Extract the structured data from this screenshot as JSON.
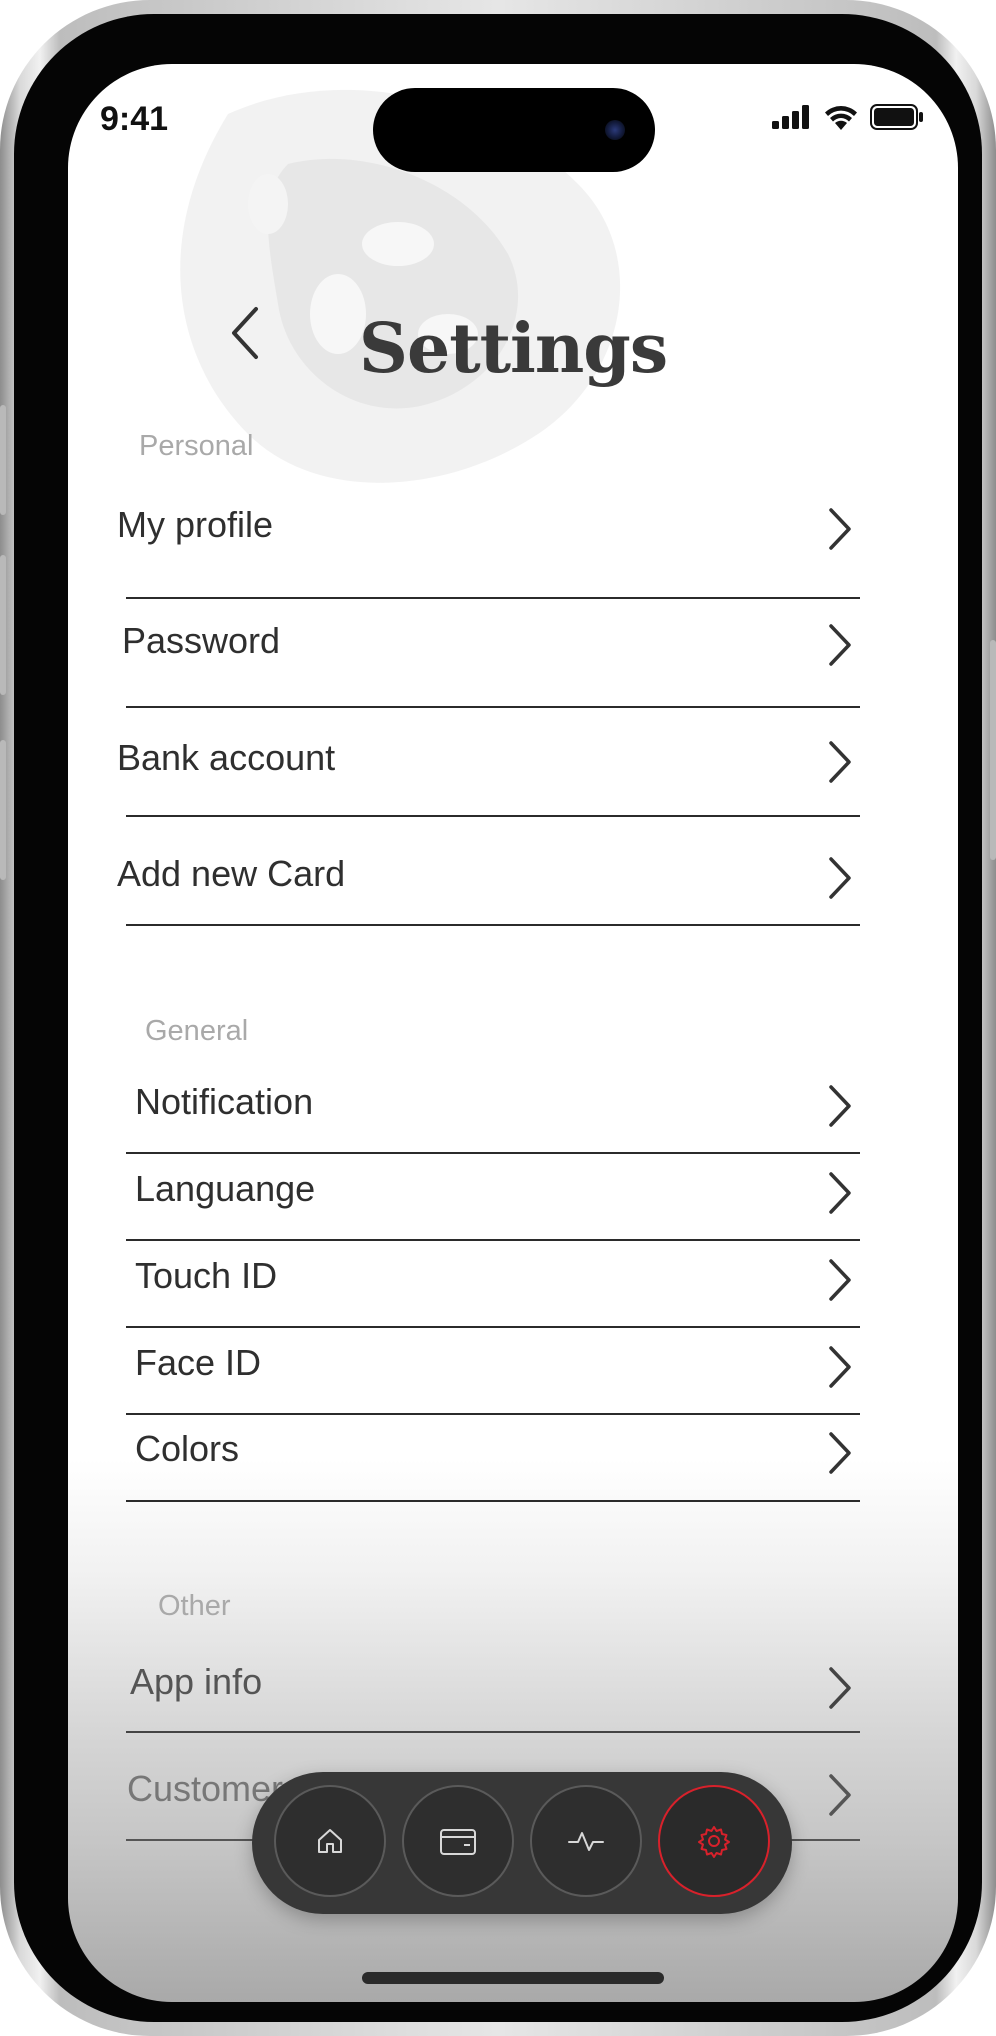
{
  "status_bar": {
    "time": "9:41",
    "icons": [
      "cellular-signal-icon",
      "wifi-icon",
      "battery-icon"
    ]
  },
  "header": {
    "title": "Settings",
    "back_icon": "chevron-left-icon"
  },
  "sections": {
    "personal": {
      "label": "Personal",
      "items": [
        "My profile",
        "Password",
        "Bank account",
        "Add new Card"
      ]
    },
    "general": {
      "label": "General",
      "items": [
        "Notification",
        "Languange",
        "Touch ID",
        "Face ID",
        "Colors"
      ]
    },
    "other": {
      "label": "Other",
      "items": [
        "App info",
        "Customer"
      ]
    }
  },
  "bottom_nav": {
    "items": [
      {
        "icon": "home-icon",
        "active": false
      },
      {
        "icon": "wallet-icon",
        "active": false
      },
      {
        "icon": "activity-icon",
        "active": false
      },
      {
        "icon": "gear-icon",
        "active": true
      }
    ],
    "active_color": "#d8212b"
  },
  "colors": {
    "text": "#2f2f2f",
    "section_label": "#a9a9a9",
    "divider": "#2b2b2b",
    "nav_background": "#373737",
    "accent": "#d8212b"
  }
}
